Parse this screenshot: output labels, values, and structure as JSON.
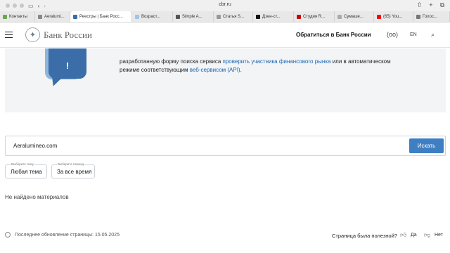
{
  "browser": {
    "url": "cbr.ru",
    "tabs": [
      {
        "label": "Контакты",
        "color": "#6aa84f"
      },
      {
        "label": "Aeralumi...",
        "color": "#888888"
      },
      {
        "label": "Реестры | Банк Росс...",
        "color": "#3b6ea8",
        "active": true
      },
      {
        "label": "Возраст...",
        "color": "#9fc5e8"
      },
      {
        "label": "Simple A...",
        "color": "#555555"
      },
      {
        "label": "Статья S...",
        "color": "#999999"
      },
      {
        "label": "Дзен-ст...",
        "color": "#111111"
      },
      {
        "label": "Студия R...",
        "color": "#cc0000"
      },
      {
        "label": "Сумаше...",
        "color": "#aaaaaa"
      },
      {
        "label": "(65) You...",
        "color": "#ff0000"
      },
      {
        "label": "Голос...",
        "color": "#777777"
      }
    ]
  },
  "header": {
    "logo_text": "Банк России",
    "contact_label": "Обратиться в Банк России",
    "lang_label": "EN"
  },
  "banner": {
    "line1_prefix": "разработанную форму поиска сервиса ",
    "line1_link": "проверить участника финансового рынка",
    "line1_suffix": " или в автоматическом",
    "line2_prefix": "режиме соответствующим ",
    "line2_link": "веб-сервисом (API)",
    "line2_suffix": ".",
    "icon_mark": "!"
  },
  "search": {
    "value": "Aeralumineo.com",
    "button_label": "Искать"
  },
  "filters": [
    {
      "label": "Выберите тему",
      "value": "Любая тема"
    },
    {
      "label": "Выберите период",
      "value": "За все время"
    }
  ],
  "results": {
    "empty_text": "Не найдено материалов"
  },
  "footer": {
    "update_text": "Последнее обновление страницы: 15.05.2025",
    "helpful_question": "Страница была полезной?",
    "yes_label": "Да",
    "no_label": "Нет"
  }
}
